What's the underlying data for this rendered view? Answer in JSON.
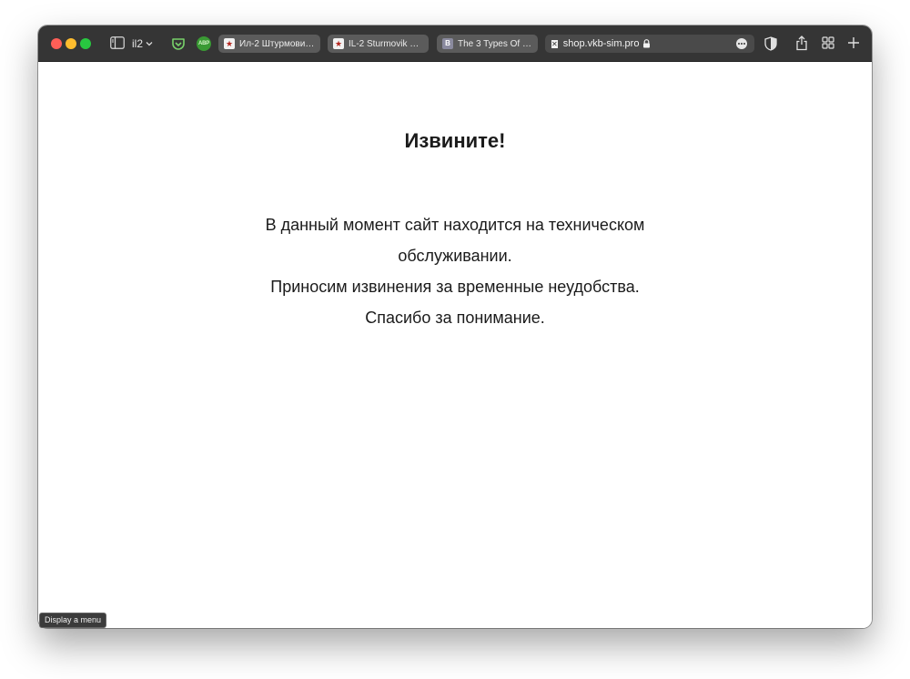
{
  "browser": {
    "tab_group_name": "il2",
    "extensions": {
      "abp_label": "ABP"
    },
    "tabs": [
      {
        "title": "Ил-2 Штурмови…",
        "favicon": "star-icon"
      },
      {
        "title": "IL-2 Sturmovik Fo…",
        "favicon": "star-icon"
      },
      {
        "title": "The 3 Types Of S…",
        "favicon": "letter-b-icon",
        "favicon_letter": "B"
      }
    ],
    "address_bar": {
      "url": "shop.vkb-sim.pro",
      "secure": true,
      "favicon": "close-box-icon"
    },
    "colors": {
      "toolbar": "#353535",
      "tab": "#5b5b5b",
      "close": "#fe5f57",
      "minimize": "#febc2e",
      "zoom": "#28c840"
    }
  },
  "page": {
    "heading": "Извините!",
    "lines": [
      "В данный момент сайт находится на техническом обслуживании.",
      "Приносим извинения за временные неудобства.",
      "Спасибо за понимание."
    ]
  },
  "tooltip": {
    "text": "Display a menu"
  }
}
